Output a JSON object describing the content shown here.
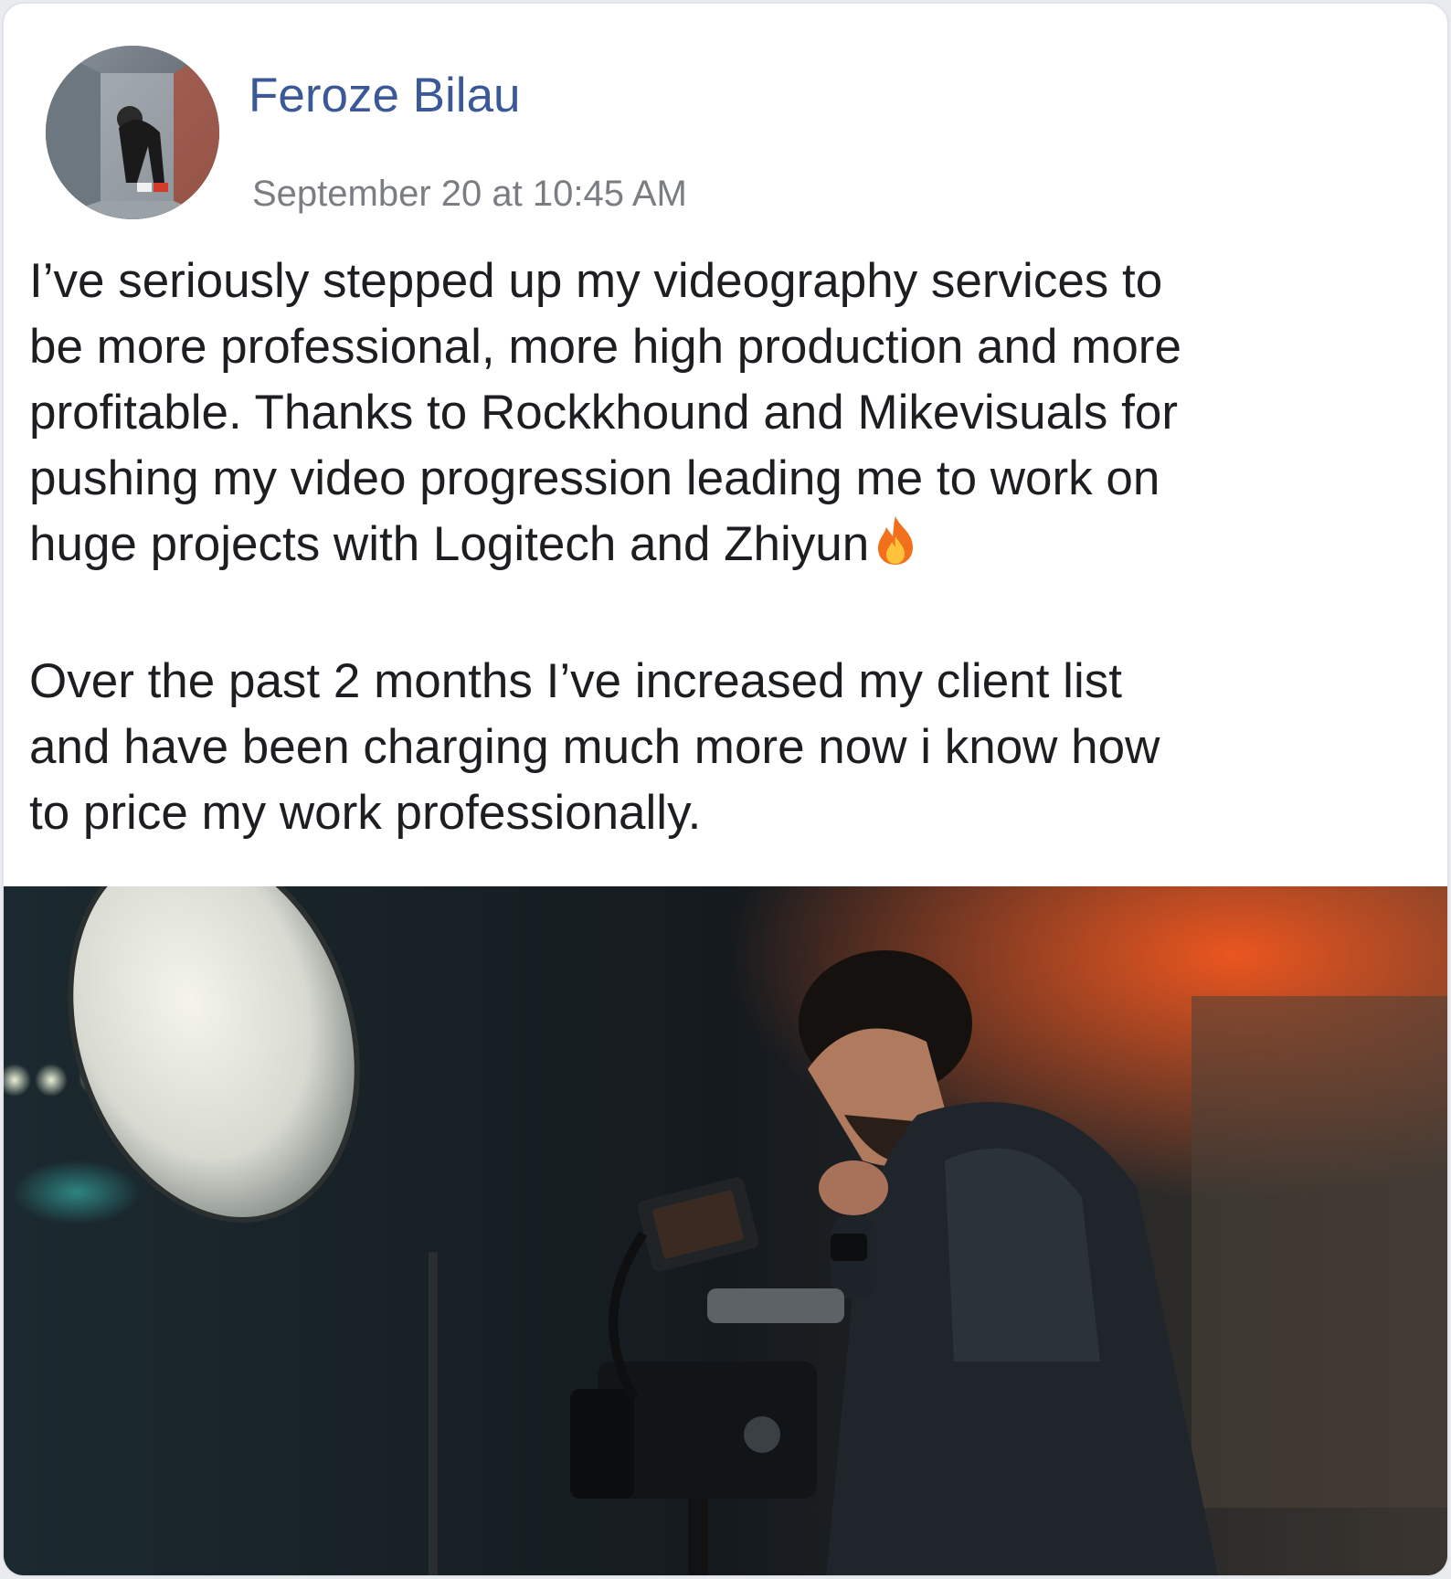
{
  "post": {
    "author_name": "Feroze Bilau",
    "timestamp": "September 20 at 10:45 AM",
    "paragraphs": [
      "I’ve seriously stepped up my videography services to\nbe more professional, more high production and more\nprofitable. Thanks to Rockkhound and Mikevisuals for\npushing my video progression leading me to work on\nhuge projects with Logitech and Zhiyun",
      "Over the past 2 months I’ve increased my client list\nand have been charging much more now i know how\nto price my work professionally."
    ],
    "emoji_icon": "fire-icon"
  },
  "colors": {
    "author_name": "#3b5998",
    "timestamp": "#7a7d82",
    "body_text": "#1c1e21",
    "card_border": "#dfe3ea"
  }
}
